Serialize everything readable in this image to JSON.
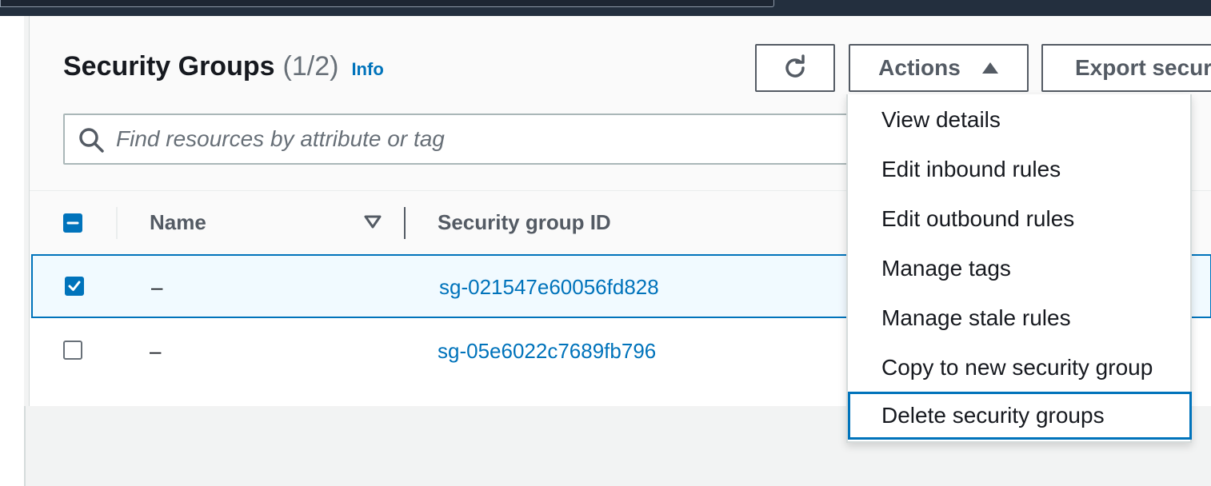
{
  "header": {
    "title": "Security Groups",
    "count": "(1/2)",
    "info": "Info"
  },
  "toolbar": {
    "refresh_icon": "refresh-icon",
    "actions_label": "Actions",
    "actions_icon": "caret-up-icon",
    "export_label": "Export secur"
  },
  "search": {
    "placeholder": "Find resources by attribute or tag",
    "icon": "search-icon"
  },
  "table": {
    "columns": [
      "Name",
      "Security group ID"
    ],
    "rows": [
      {
        "name": "–",
        "id": "sg-021547e60056fd828",
        "selected": true
      },
      {
        "name": "–",
        "id": "sg-05e6022c7689fb796",
        "selected": false
      }
    ]
  },
  "actions_menu": {
    "items": [
      "View details",
      "Edit inbound rules",
      "Edit outbound rules",
      "Manage tags",
      "Manage stale rules",
      "Copy to new security group",
      "Delete security groups"
    ],
    "focused_index": 6
  },
  "colors": {
    "accent": "#0073bb",
    "nav": "#232f3e",
    "text": "#16191f"
  }
}
